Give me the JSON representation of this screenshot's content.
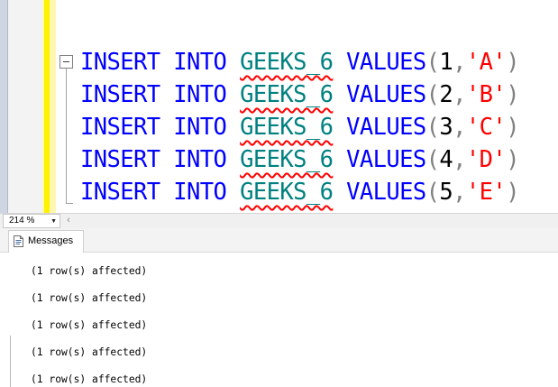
{
  "editor": {
    "code_lines": [
      {
        "kw1": "INSERT",
        "kw2": "INTO",
        "table": "GEEKS_6",
        "kw3": "VALUES",
        "open": "(",
        "num": "1",
        "comma": ",",
        "str": "'A'",
        "close": ")"
      },
      {
        "kw1": "INSERT",
        "kw2": "INTO",
        "table": "GEEKS_6",
        "kw3": "VALUES",
        "open": "(",
        "num": "2",
        "comma": ",",
        "str": "'B'",
        "close": ")"
      },
      {
        "kw1": "INSERT",
        "kw2": "INTO",
        "table": "GEEKS_6",
        "kw3": "VALUES",
        "open": "(",
        "num": "3",
        "comma": ",",
        "str": "'C'",
        "close": ")"
      },
      {
        "kw1": "INSERT",
        "kw2": "INTO",
        "table": "GEEKS_6",
        "kw3": "VALUES",
        "open": "(",
        "num": "4",
        "comma": ",",
        "str": "'D'",
        "close": ")"
      },
      {
        "kw1": "INSERT",
        "kw2": "INTO",
        "table": "GEEKS_6",
        "kw3": "VALUES",
        "open": "(",
        "num": "5",
        "comma": ",",
        "str": "'E'",
        "close": ")"
      }
    ],
    "colors": {
      "keyword": "#0000ff",
      "table": "#008080",
      "punctuation": "#808080",
      "string": "#ff0000",
      "squiggle": "#ff0000",
      "change_bar": "#fff100"
    }
  },
  "zoom": {
    "value": "214 %",
    "arrow_icon": "dropdown-arrow-icon"
  },
  "results": {
    "tab_label": "Messages",
    "tab_icon": "messages-icon",
    "messages": [
      "(1 row(s) affected)",
      "(1 row(s) affected)",
      "(1 row(s) affected)",
      "(1 row(s) affected)",
      "(1 row(s) affected)"
    ]
  }
}
